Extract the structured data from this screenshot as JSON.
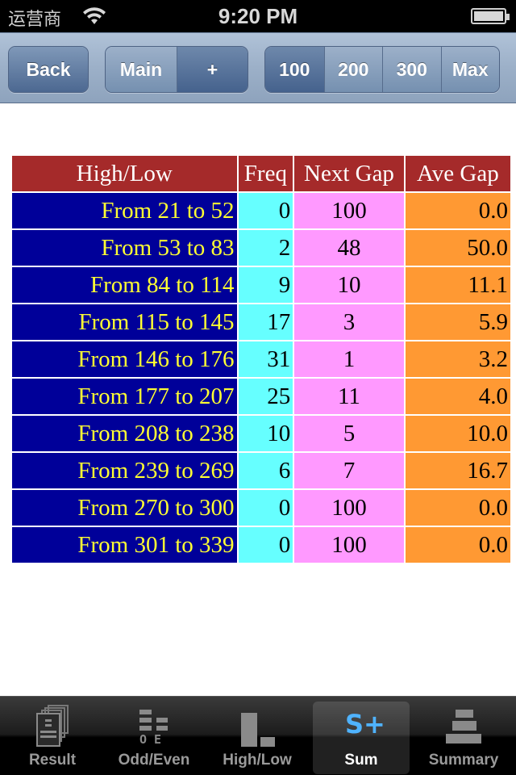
{
  "status_bar": {
    "carrier": "运营商",
    "time": "9:20 PM",
    "battery_level": 1.0
  },
  "toolbar": {
    "back_label": "Back",
    "main_segments": [
      {
        "label": "Main",
        "selected": false
      },
      {
        "label": "+",
        "selected": true
      }
    ],
    "range_segments": [
      {
        "label": "100",
        "selected": true
      },
      {
        "label": "200",
        "selected": false
      },
      {
        "label": "300",
        "selected": false
      },
      {
        "label": "Max",
        "selected": false
      }
    ]
  },
  "table": {
    "headers": [
      "High/Low",
      "Freq",
      "Next Gap",
      "Ave Gap"
    ],
    "rows": [
      {
        "range": "From 21 to 52",
        "freq": "0",
        "next_gap": "100",
        "ave_gap": "0.0"
      },
      {
        "range": "From 53 to 83",
        "freq": "2",
        "next_gap": "48",
        "ave_gap": "50.0"
      },
      {
        "range": "From 84 to 114",
        "freq": "9",
        "next_gap": "10",
        "ave_gap": "11.1"
      },
      {
        "range": "From 115 to 145",
        "freq": "17",
        "next_gap": "3",
        "ave_gap": "5.9"
      },
      {
        "range": "From 146 to 176",
        "freq": "31",
        "next_gap": "1",
        "ave_gap": "3.2"
      },
      {
        "range": "From 177 to 207",
        "freq": "25",
        "next_gap": "11",
        "ave_gap": "4.0"
      },
      {
        "range": "From 208 to 238",
        "freq": "10",
        "next_gap": "5",
        "ave_gap": "10.0"
      },
      {
        "range": "From 239 to 269",
        "freq": "6",
        "next_gap": "7",
        "ave_gap": "16.7"
      },
      {
        "range": "From 270 to 300",
        "freq": "0",
        "next_gap": "100",
        "ave_gap": "0.0"
      },
      {
        "range": "From 301 to 339",
        "freq": "0",
        "next_gap": "100",
        "ave_gap": "0.0"
      }
    ]
  },
  "colors": {
    "header_bg": "#a52a2a",
    "range_bg": "#000099",
    "range_text": "#ffff33",
    "freq_bg": "#66ffff",
    "next_gap_bg": "#ff99ff",
    "ave_gap_bg": "#ff9933",
    "sum_icon_accent": "#4fb3ff"
  },
  "tab_bar": {
    "tabs": [
      {
        "label": "Result",
        "icon": "result-stack-icon",
        "selected": false
      },
      {
        "label": "Odd/Even",
        "icon": "odd-even-icon",
        "selected": false
      },
      {
        "label": "High/Low",
        "icon": "high-low-icon",
        "selected": false
      },
      {
        "label": "Sum",
        "icon": "sum-plus-icon",
        "selected": true
      },
      {
        "label": "Summary",
        "icon": "summary-stack-icon",
        "selected": false
      }
    ]
  }
}
